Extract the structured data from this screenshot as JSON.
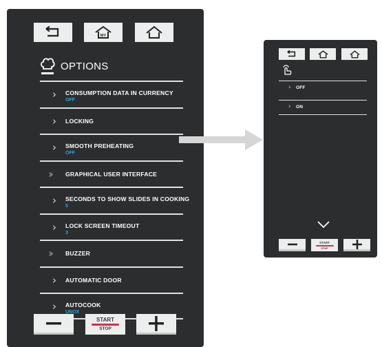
{
  "left": {
    "options_title": "OPTIONS",
    "items": [
      {
        "label": "CONSUMPTION DATA IN CURRENCY",
        "value": "OFF",
        "chevron": "single"
      },
      {
        "label": "LOCKING",
        "value": "",
        "chevron": "single"
      },
      {
        "label": "SMOOTH PREHEATING",
        "value": "OFF",
        "chevron": "single"
      },
      {
        "label": "GRAPHICAL USER INTERFACE",
        "value": "",
        "chevron": "double"
      },
      {
        "label": "SECONDS TO SHOW SLIDES IN COOKING",
        "value": "5",
        "chevron": "single"
      },
      {
        "label": "LOCK SCREEN TIMEOUT",
        "value": "3",
        "chevron": "single"
      },
      {
        "label": "BUZZER",
        "value": "",
        "chevron": "double"
      },
      {
        "label": "AUTOMATIC DOOR",
        "value": "",
        "chevron": "single"
      },
      {
        "label": "AUTOCOOK",
        "value": "UNOX",
        "chevron": "single"
      }
    ],
    "start_label": "START",
    "stop_label": "STOP"
  },
  "right": {
    "options": [
      {
        "label": "OFF"
      },
      {
        "label": "ON"
      }
    ],
    "start_label": "START",
    "stop_label": "STOP"
  },
  "icons": {
    "back": "back-arrow-icon",
    "my_home": "my-home-icon",
    "home": "home-icon",
    "chef": "chef-hat-icon",
    "touch": "touch-finger-icon",
    "scroll_down": "chevron-down-icon",
    "minus": "minus-icon",
    "plus": "plus-icon",
    "arrow": "right-arrow-icon"
  },
  "colors": {
    "panel": "#2b2d2f",
    "accent_value": "#29a8e0",
    "start_stop_line": "#d32f4a",
    "button": "#eceded"
  }
}
